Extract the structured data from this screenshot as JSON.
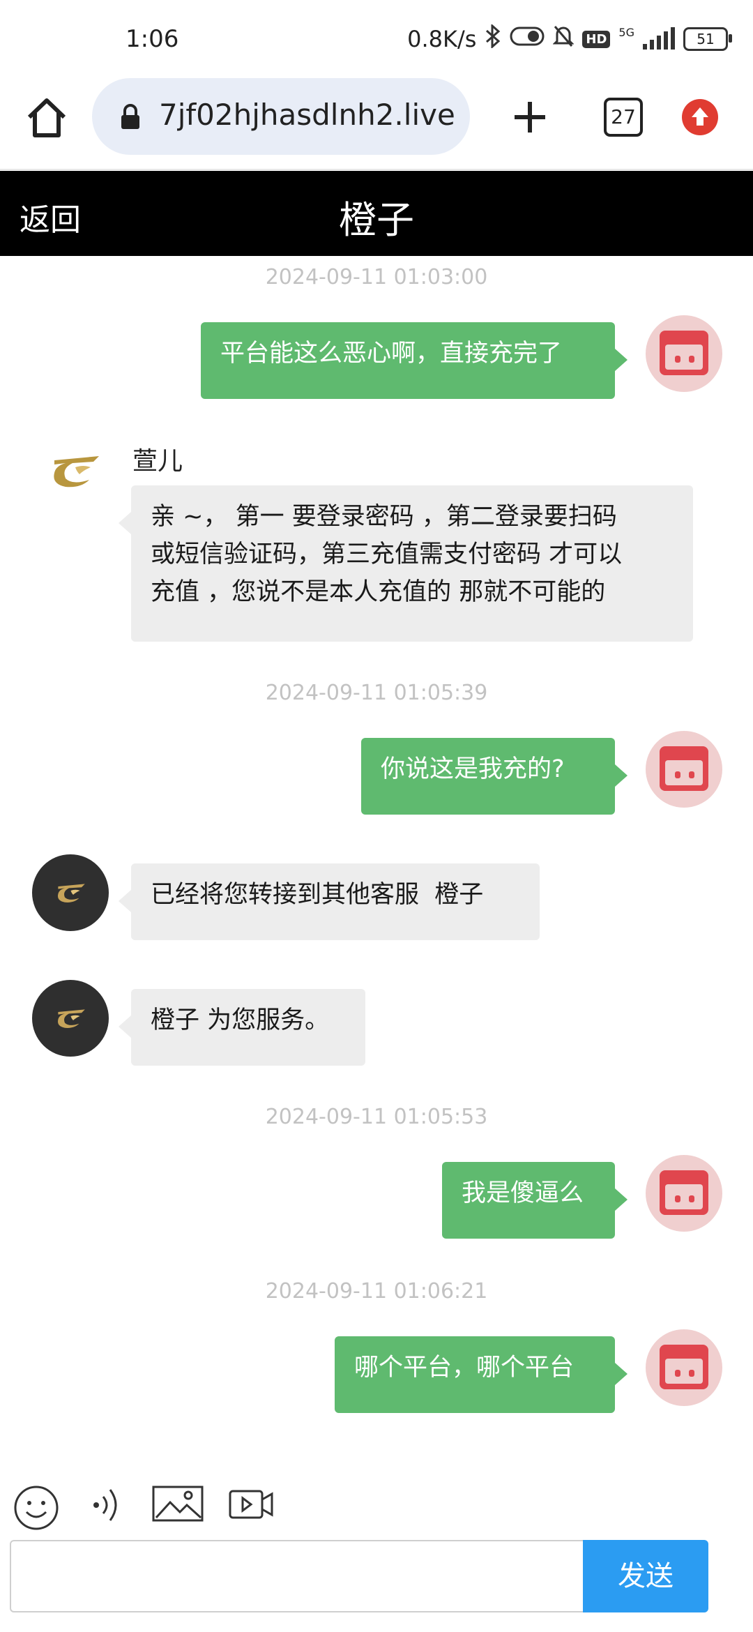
{
  "status_bar": {
    "time": "1:06",
    "speed": "0.8K/s",
    "network": "5G",
    "battery": "51"
  },
  "browser": {
    "url": "7jf02hjhasdlnh2.live",
    "tab_count": "27"
  },
  "header": {
    "back_label": "返回",
    "title": "橙子"
  },
  "timestamps": [
    "2024-09-11 01:03:00",
    "2024-09-11 01:05:39",
    "2024-09-11 01:05:53",
    "2024-09-11 01:06:21"
  ],
  "messages": [
    {
      "side": "out",
      "text": "平台能这么恶心啊，直接充完了"
    },
    {
      "side": "in",
      "sender": "萱儿",
      "lines": [
        "亲 ~， 第一 要登录密码 ，第二登录要扫码",
        "或短信验证码，第三充值需支付密码 才可以",
        "充值 ，您说不是本人充值的 那就不可能的"
      ]
    },
    {
      "side": "out",
      "text": "你说这是我充的?"
    },
    {
      "side": "in",
      "text": "已经将您转接到其他客服  橙子"
    },
    {
      "side": "in",
      "text": "橙子 为您服务。"
    },
    {
      "side": "out",
      "text": "我是傻逼么"
    },
    {
      "side": "out",
      "text": "哪个平台，哪个平台"
    }
  ],
  "composer": {
    "input_value": "",
    "send_label": "发送"
  },
  "icons": [
    "home-icon",
    "lock-icon",
    "plus-icon",
    "tabs-icon",
    "update-icon",
    "emoji-icon",
    "voice-icon",
    "image-icon",
    "video-icon"
  ],
  "colors": {
    "outgoing_bubble": "#5fba6f",
    "incoming_bubble": "#ededed",
    "send_button": "#2b9cf2",
    "header_bg": "#000000"
  }
}
